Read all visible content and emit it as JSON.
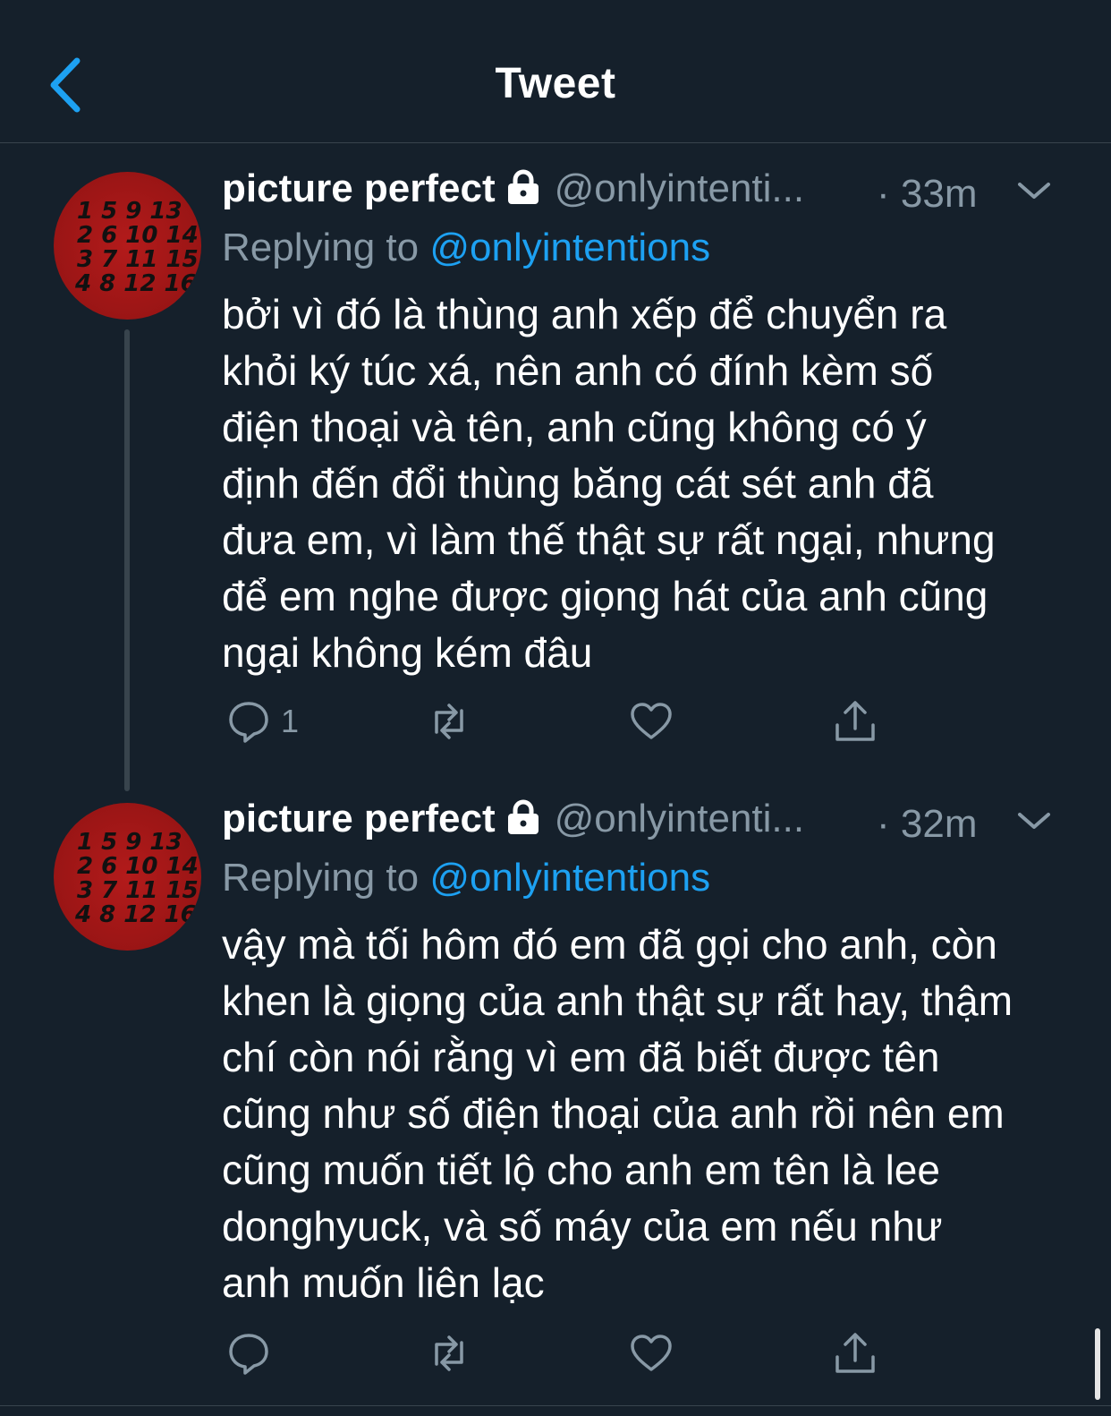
{
  "header": {
    "title": "Tweet",
    "back_icon": "chevron-left-icon",
    "accent": "#1da1f2"
  },
  "tweets": [
    {
      "author": {
        "name": "picture perfect",
        "handle": "@onlyintenti...",
        "protected_icon": "lock-icon",
        "avatar_digits": [
          "1 5 9 13",
          "2 6 10 14",
          "3 7 11 15",
          "4 8 12 16"
        ]
      },
      "time": "· 33m",
      "replying_label": "Replying to",
      "replying_to": "@onlyintentions",
      "text": "bởi vì đó là thùng anh xếp để chuyển ra\nkhỏi ký túc xá, nên anh có đính kèm số\nđiện thoại và tên, anh cũng không có ý\nđịnh đến đổi thùng băng cát sét anh đã\nđưa em, vì làm thế thật sự rất ngại, nhưng\nđể em nghe được giọng hát của anh cũng\nngại không kém đâu",
      "actions": {
        "reply_count": "1",
        "retweet_count": "",
        "like_count": ""
      }
    },
    {
      "author": {
        "name": "picture perfect",
        "handle": "@onlyintenti...",
        "protected_icon": "lock-icon",
        "avatar_digits": [
          "1 5 9 13",
          "2 6 10 14",
          "3 7 11 15",
          "4 8 12 16"
        ]
      },
      "time": "· 32m",
      "replying_label": "Replying to",
      "replying_to": "@onlyintentions",
      "text": "vậy mà tối hôm đó em đã gọi cho anh, còn\nkhen là giọng của anh thật sự rất hay, thậm\nchí còn nói rằng vì em đã biết được tên\ncũng như số điện thoại của anh rồi nên em\ncũng muốn tiết lộ cho anh em tên là lee\ndonghyuck, và số máy của em nếu như\nanh muốn liên lạc",
      "actions": {
        "reply_count": "",
        "retweet_count": "",
        "like_count": ""
      }
    }
  ],
  "colors": {
    "background": "#15202b",
    "secondary_text": "#8899a6",
    "link": "#1da1f2",
    "divider": "#38444d",
    "avatar_red": "#a31818"
  }
}
